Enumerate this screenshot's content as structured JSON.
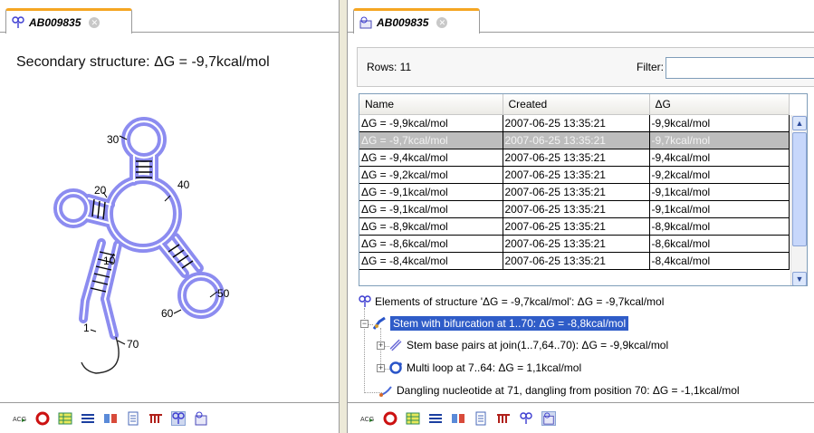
{
  "left_panel": {
    "tab_title": "AB009835",
    "structure_title": "Secondary structure: ΔG = -9,7kcal/mol",
    "position_labels": [
      "30",
      "40",
      "20",
      "10",
      "50",
      "60",
      "1",
      "70"
    ],
    "toolbar_icons": [
      "rna-text-icon",
      "circle-view-icon",
      "table-view-icon",
      "list-view-icon",
      "book-icon",
      "text-doc-icon",
      "bar-graph-icon",
      "secondary-structure-icon",
      "structure-table-icon"
    ]
  },
  "right_panel": {
    "tab_title": "AB009835",
    "rows_label": "Rows: 11",
    "filter_label": "Filter:",
    "filter_value": "",
    "columns": [
      "Name",
      "Created",
      "ΔG"
    ],
    "rows": [
      [
        "ΔG = -9,9kcal/mol",
        "2007-06-25 13:35:21",
        "-9,9kcal/mol"
      ],
      [
        "ΔG = -9,7kcal/mol",
        "2007-06-25 13:35:21",
        "-9,7kcal/mol"
      ],
      [
        "ΔG = -9,4kcal/mol",
        "2007-06-25 13:35:21",
        "-9,4kcal/mol"
      ],
      [
        "ΔG = -9,2kcal/mol",
        "2007-06-25 13:35:21",
        "-9,2kcal/mol"
      ],
      [
        "ΔG = -9,1kcal/mol",
        "2007-06-25 13:35:21",
        "-9,1kcal/mol"
      ],
      [
        "ΔG = -9,1kcal/mol",
        "2007-06-25 13:35:21",
        "-9,1kcal/mol"
      ],
      [
        "ΔG = -8,9kcal/mol",
        "2007-06-25 13:35:21",
        "-8,9kcal/mol"
      ],
      [
        "ΔG = -8,6kcal/mol",
        "2007-06-25 13:35:21",
        "-8,6kcal/mol"
      ],
      [
        "ΔG = -8,4kcal/mol",
        "2007-06-25 13:35:21",
        "-8,4kcal/mol"
      ]
    ],
    "selected_row": 1,
    "tree": {
      "root": "Elements of structure 'ΔG = -9,7kcal/mol': ΔG = -9,7kcal/mol",
      "stem": "Stem with bifurcation at 1..70: ΔG = -8,8kcal/mol",
      "stem_pairs": "Stem base pairs at join(1..7,64..70): ΔG = -9,9kcal/mol",
      "multiloop": "Multi loop at 7..64: ΔG = 1,1kcal/mol",
      "dangling": "Dangling nucleotide at 71, dangling from position 70: ΔG = -1,1kcal/mol"
    },
    "toolbar_icons": [
      "rna-text-icon",
      "circle-view-icon",
      "table-view-icon",
      "list-view-icon",
      "book-icon",
      "text-doc-icon",
      "bar-graph-icon",
      "secondary-structure-icon",
      "structure-table-icon"
    ]
  },
  "colors": {
    "structure_highlight": "#8c8cf0",
    "selection_blue": "#2f5cc8",
    "tab_accent": "#f5a623"
  }
}
